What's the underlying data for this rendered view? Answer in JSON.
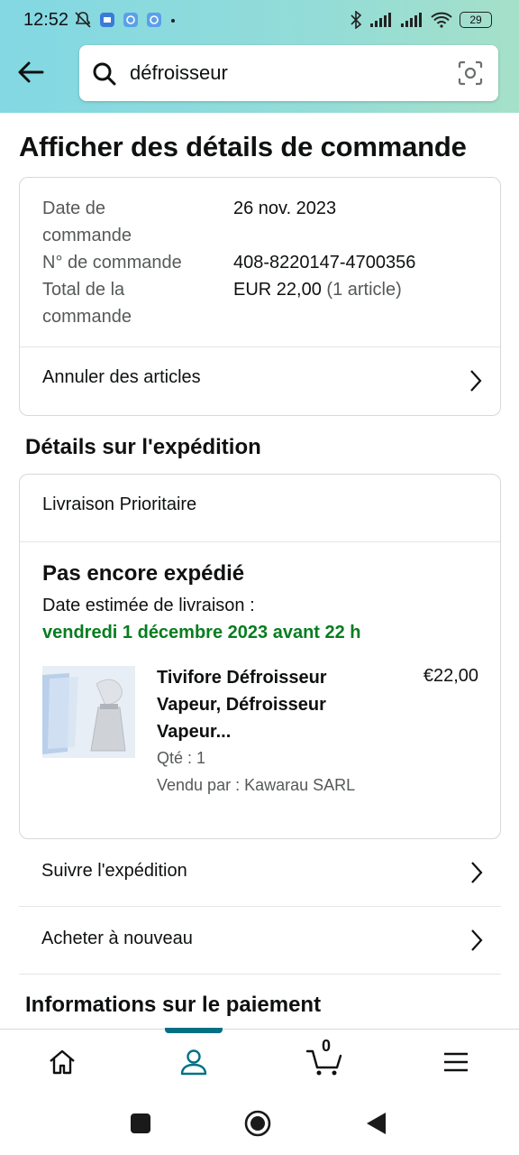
{
  "status_bar": {
    "time": "12:52",
    "battery": "29"
  },
  "search": {
    "value": "défroisseur"
  },
  "page_title": "Afficher des détails de commande",
  "order": {
    "date_label_1": "Date de",
    "date_label_2": "commande",
    "date_value": "26 nov. 2023",
    "number_label": "N° de commande",
    "number_value": "408-8220147-4700356",
    "total_label_1": "Total de la",
    "total_label_2": "commande",
    "total_value": "EUR 22,00",
    "total_count": "(1 article)",
    "cancel_label": "Annuler des articles"
  },
  "shipping": {
    "section_title": "Détails sur l'expédition",
    "method": "Livraison Prioritaire",
    "status": "Pas encore expédié",
    "estimate_label": "Date estimée de livraison :",
    "estimate_date": "vendredi 1 décembre 2023 avant 22 h",
    "product": {
      "title": "Tivifore Défroisseur Vapeur, Défroisseur Vapeur...",
      "price": "€22,00",
      "qty": "Qté : 1",
      "seller": "Vendu par : Kawarau SARL"
    }
  },
  "actions": {
    "track": "Suivre l'expédition",
    "buy_again": "Acheter à nouveau"
  },
  "payment": {
    "section_title": "Informations sur le paiement"
  },
  "bottom_nav": {
    "cart_count": "0"
  },
  "colors": {
    "accent": "#007185",
    "delivery_green": "#067d1f"
  }
}
